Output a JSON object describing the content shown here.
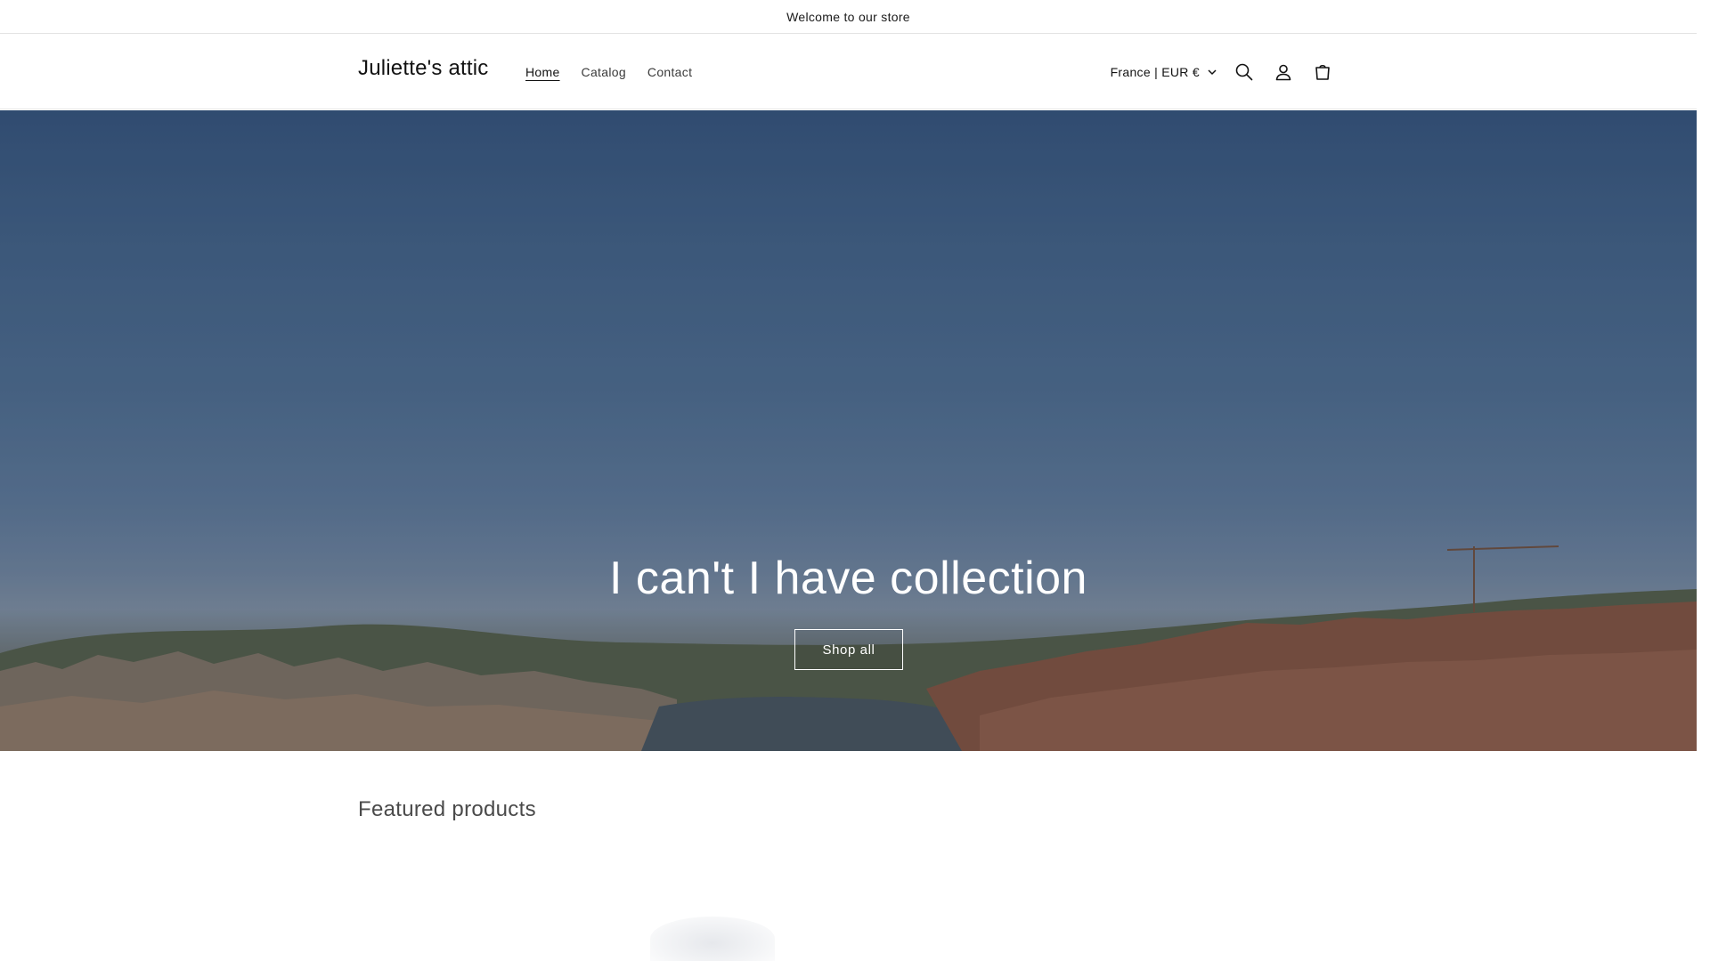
{
  "announcement": {
    "text": "Welcome to our store"
  },
  "header": {
    "logo": "Juliette's attic",
    "nav": [
      {
        "label": "Home",
        "active": true
      },
      {
        "label": "Catalog",
        "active": false
      },
      {
        "label": "Contact",
        "active": false
      }
    ],
    "localization": "France | EUR €",
    "icons": [
      "search-icon",
      "account-icon",
      "cart-icon"
    ]
  },
  "hero": {
    "title": "I can't I have collection",
    "button_label": "Shop all"
  },
  "featured": {
    "title": "Featured products"
  },
  "colors": {
    "text": "#121212",
    "border": "#e3e3e3",
    "sky": "#4a6d98"
  }
}
